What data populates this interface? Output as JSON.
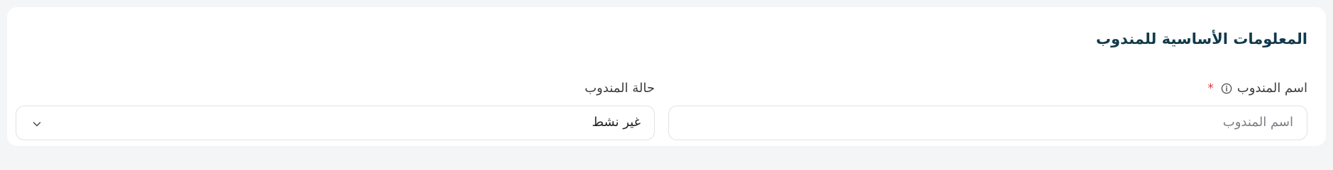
{
  "section": {
    "title": "المعلومات الأساسية للمندوب"
  },
  "fields": {
    "name": {
      "label": "اسم المندوب",
      "required_mark": "*",
      "placeholder": "اسم المندوب",
      "icon": "info-icon"
    },
    "status": {
      "label": "حالة المندوب",
      "selected": "غير نشط",
      "icon": "chevron-down-icon"
    }
  },
  "colors": {
    "title": "#123a4a",
    "required": "#e0383e",
    "border": "#dfe2e6"
  }
}
